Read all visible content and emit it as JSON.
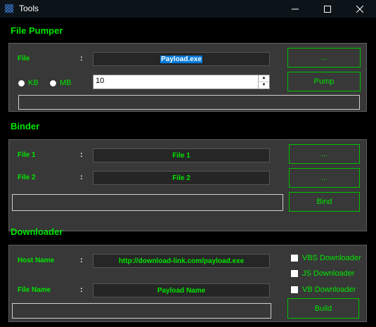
{
  "window": {
    "title": "Tools"
  },
  "file_pumper": {
    "section_title": "File Pumper",
    "file_label": "File",
    "colon": ":",
    "file_value": "Payload.exe",
    "browse_label": "...",
    "size_units": [
      {
        "label": "KB"
      },
      {
        "label": "MB"
      }
    ],
    "size_value": "10",
    "pump_label": "Pump"
  },
  "binder": {
    "section_title": "Binder",
    "file1_label": "File 1",
    "file1_value": "File 1",
    "file2_label": "File 2",
    "file2_value": "File 2",
    "colon": ":",
    "browse1_label": "...",
    "browse2_label": "...",
    "bind_label": "Bind"
  },
  "downloader": {
    "section_title": "Downloader",
    "host_label": "Host Name",
    "host_value": "http://download-link.com/payload.exe",
    "file_label": "File Name",
    "file_value": "Payload Name",
    "colon": ":",
    "options": [
      {
        "label": "VBS Downloader"
      },
      {
        "label": "JS Downloader"
      },
      {
        "label": "VB Downloader"
      }
    ],
    "build_label": "Build"
  },
  "colors": {
    "accent": "#00e600",
    "panel": "#383838",
    "background": "#000000"
  },
  "icons": {
    "app": "grid-icon",
    "minimize": "minimize-icon",
    "maximize": "maximize-icon",
    "close": "close-icon"
  }
}
